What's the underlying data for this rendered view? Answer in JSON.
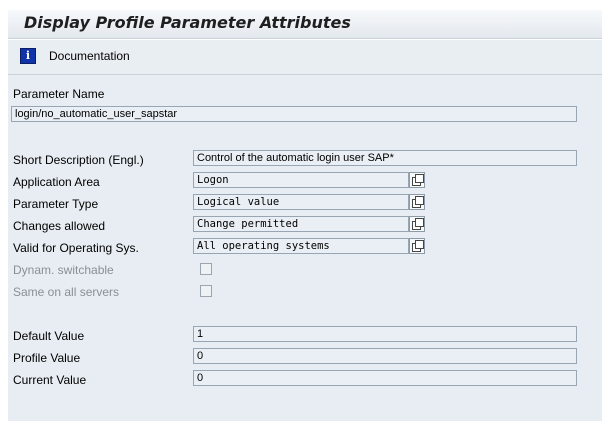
{
  "window": {
    "title": "Display Profile Parameter Attributes"
  },
  "toolbar": {
    "documentation_label": "Documentation",
    "icon": "info-icon"
  },
  "parameter": {
    "name_label": "Parameter Name",
    "name_value": "login/no_automatic_user_sapstar"
  },
  "attributes": {
    "short_desc_label": "Short Description (Engl.)",
    "short_desc_value": "Control of the automatic login user SAP*",
    "app_area_label": "Application Area",
    "app_area_value": "Logon",
    "param_type_label": "Parameter Type",
    "param_type_value": "Logical value",
    "changes_label": "Changes allowed",
    "changes_value": "Change permitted",
    "valid_os_label": "Valid for Operating Sys.",
    "valid_os_value": "All operating systems",
    "dynam_label": "Dynam. switchable",
    "dynam_checked": false,
    "same_servers_label": "Same on all servers",
    "same_servers_checked": false
  },
  "values": {
    "default_label": "Default Value",
    "default_value": "1",
    "profile_label": "Profile Value",
    "profile_value": "0",
    "current_label": "Current Value",
    "current_value": "0"
  }
}
